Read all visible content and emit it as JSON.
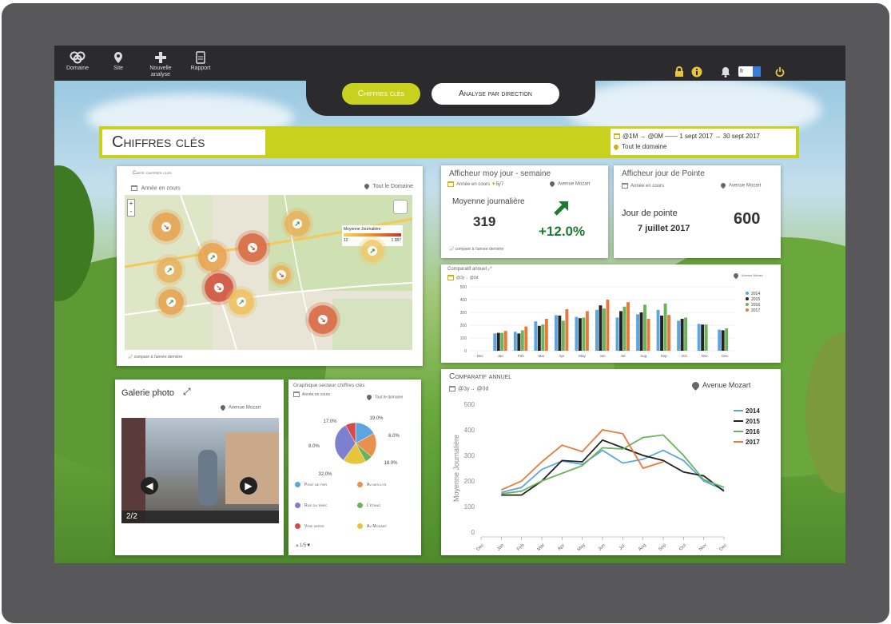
{
  "nav": {
    "items": [
      {
        "label": "Domaine",
        "icon": "domain-pins-icon"
      },
      {
        "label": "Site",
        "icon": "pin-icon"
      },
      {
        "label": "Nouvelle analyse",
        "icon": "plus-icon"
      },
      {
        "label": "Rapport",
        "icon": "document-icon"
      }
    ],
    "lang": "fr",
    "accent": "#c8d21e"
  },
  "tabs": [
    {
      "label": "Chiffres clés",
      "active": true
    },
    {
      "label": "Analyse par direction",
      "active": false
    }
  ],
  "header": {
    "title": "Chiffres clés",
    "period": "@1M → @0M —— 1 sept 2017 → 30 sept 2017",
    "scope": "Tout le domaine"
  },
  "map": {
    "title": "Carte chiffres clés",
    "period": "Année en cours",
    "scope": "Tout le Domaine",
    "legend_title": "Moyenne Journalière",
    "legend_min": "12",
    "legend_max": "1 387",
    "footer": "comparé à l'année dernière",
    "markers": [
      {
        "dir": "down"
      },
      {
        "dir": "up"
      },
      {
        "dir": "up"
      },
      {
        "dir": "down"
      },
      {
        "dir": "up"
      },
      {
        "dir": "down"
      },
      {
        "dir": "up"
      },
      {
        "dir": "up"
      },
      {
        "dir": "down"
      },
      {
        "dir": "up"
      },
      {
        "dir": "down"
      }
    ]
  },
  "avg": {
    "title": "Afficheur moy jour - semaine",
    "period": "Année en cours",
    "filter": "5j/7",
    "scope": "Avenue Mozart",
    "label": "Moyenne journalière",
    "value": "319",
    "change": "+12.0%",
    "footer": "comparé à l'année dernière"
  },
  "peak": {
    "title": "Afficheur jour de Pointe",
    "period": "Année en cours",
    "scope": "Avenue Mozart",
    "label": "Jour de pointe",
    "date": "7 juillet 2017",
    "value": "600"
  },
  "gallery": {
    "title": "Galerie photo",
    "scope": "Avenue Mozart",
    "counter": "2/2"
  },
  "pie": {
    "title": "Graphique secteur chiffres clés",
    "period": "Année en cours",
    "scope": "Tout le domaine",
    "pager": "1/5",
    "legend": [
      {
        "label": "Pont de fer",
        "color": "#5da5de"
      },
      {
        "label": "Av des lys",
        "color": "#e8904e"
      },
      {
        "label": "Rue du parc",
        "color": "#7d7fcf"
      },
      {
        "label": "L'étang",
        "color": "#6ab35a"
      },
      {
        "label": "Voie verte",
        "color": "#d84a4a"
      },
      {
        "label": "Av Mozart",
        "color": "#e6c53a"
      }
    ]
  },
  "bar_small": {
    "title": "Comparatif annuel",
    "period": "@3y→ @0d",
    "scope": "Avenue Mozart"
  },
  "line": {
    "title": "Comparatif annuel",
    "period": "@3y→ @0d",
    "scope": "Avenue Mozart"
  },
  "chart_data": [
    {
      "type": "bar",
      "title": "Comparatif annuel",
      "categories": [
        "Dec",
        "Jan",
        "Feb",
        "Mar",
        "Apr",
        "May",
        "Jun",
        "Jul",
        "Aug",
        "Sep",
        "Oct",
        "Nov",
        "Dec"
      ],
      "ylim": [
        0,
        500
      ],
      "yticks": [
        0,
        100,
        200,
        300,
        400,
        500
      ],
      "series": [
        {
          "name": "2014",
          "color": "#5da5de",
          "values": [
            null,
            135,
            148,
            230,
            278,
            265,
            320,
            260,
            285,
            320,
            235,
            210,
            165
          ]
        },
        {
          "name": "2015",
          "color": "#222222",
          "values": [
            null,
            140,
            135,
            195,
            275,
            255,
            355,
            310,
            300,
            275,
            250,
            205,
            160
          ]
        },
        {
          "name": "2016",
          "color": "#6ab35a",
          "values": [
            null,
            140,
            160,
            205,
            235,
            260,
            330,
            345,
            360,
            370,
            260,
            205,
            175
          ]
        },
        {
          "name": "2017",
          "color": "#e8793a",
          "values": [
            null,
            155,
            190,
            250,
            325,
            310,
            400,
            380,
            250,
            280,
            null,
            null,
            null
          ]
        }
      ]
    },
    {
      "type": "pie",
      "title": "Graphique secteur chiffres clés",
      "slices": [
        {
          "label": "Pont de fer",
          "value": 17.0
        },
        {
          "label": "Av des lys",
          "value": 19.0
        },
        {
          "label": "L'étang",
          "value": 6.0
        },
        {
          "label": "Av Mozart",
          "value": 18.0
        },
        {
          "label": "Rue du parc",
          "value": 32.0
        },
        {
          "label": "Voie verte",
          "value": 8.0
        }
      ]
    },
    {
      "type": "line",
      "title": "Comparatif annuel",
      "ylabel": "Moyenne Journalière",
      "categories": [
        "Dec",
        "Jan",
        "Feb",
        "Mar",
        "Apr",
        "May",
        "Jun",
        "Jul",
        "Aug",
        "Sep",
        "Oct",
        "Nov",
        "Dec"
      ],
      "ylim": [
        0,
        500
      ],
      "yticks": [
        0,
        100,
        200,
        300,
        400,
        500
      ],
      "series": [
        {
          "name": "2014",
          "color": "#5da5de",
          "values": [
            null,
            155,
            175,
            245,
            278,
            265,
            320,
            270,
            285,
            320,
            280,
            200,
            165
          ]
        },
        {
          "name": "2015",
          "color": "#222222",
          "values": [
            null,
            145,
            145,
            200,
            280,
            275,
            360,
            330,
            300,
            280,
            235,
            220,
            160
          ]
        },
        {
          "name": "2016",
          "color": "#6ab35a",
          "values": [
            null,
            150,
            160,
            200,
            230,
            260,
            330,
            325,
            370,
            380,
            300,
            205,
            175
          ]
        },
        {
          "name": "2017",
          "color": "#e8793a",
          "values": [
            null,
            165,
            200,
            275,
            340,
            315,
            400,
            385,
            250,
            275,
            null,
            null,
            null
          ]
        }
      ]
    }
  ]
}
